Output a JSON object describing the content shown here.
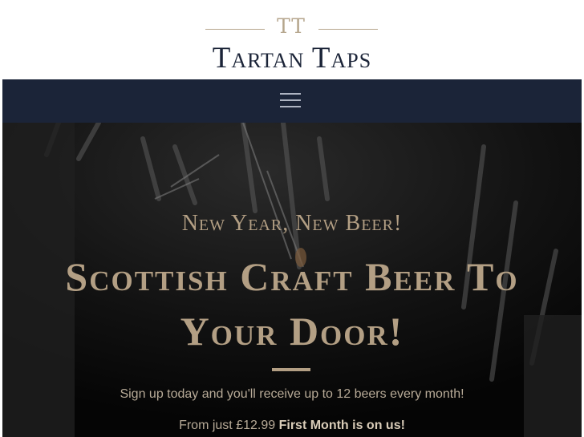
{
  "header": {
    "monogram": "TT",
    "brand_name": "Tartan Taps"
  },
  "nav": {
    "menu_icon": "hamburger-menu-icon"
  },
  "hero": {
    "eyebrow": "New Year, New Beer!",
    "headline": "Scottish Craft Beer To Your Door!",
    "subtext": "Sign up today and you'll receive up to 12 beers every month!",
    "price_prefix": "From just £12.99",
    "price_offer": "First Month is on us!"
  },
  "colors": {
    "navy": "#1b2438",
    "gold": "#b39f84",
    "hero_bg": "#0b0b0b"
  }
}
